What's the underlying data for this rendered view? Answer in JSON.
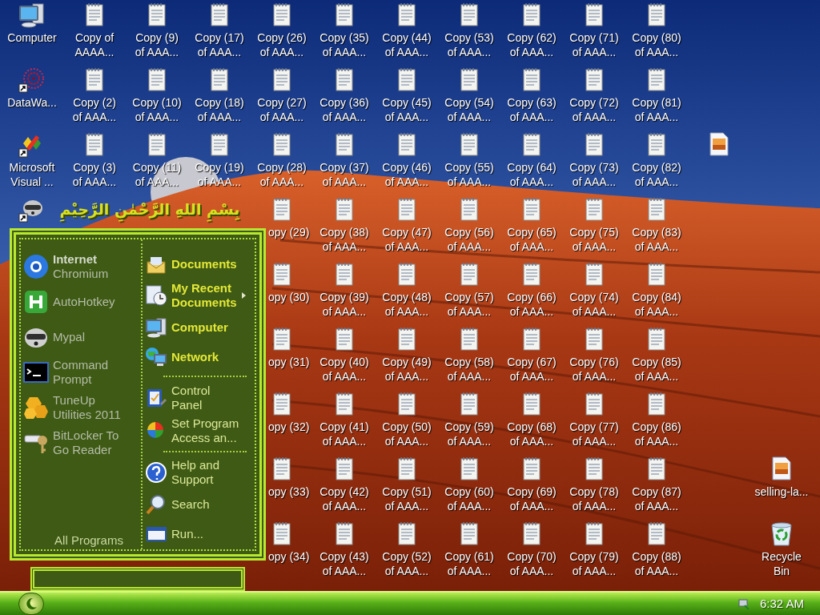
{
  "desktop": {
    "columns": [
      [
        {
          "kind": "computer",
          "lines": [
            "Computer"
          ]
        },
        {
          "kind": "datawave",
          "lines": [
            "DataWa..."
          ]
        },
        {
          "kind": "studio",
          "lines": [
            "Microsoft",
            "Visual ..."
          ]
        },
        {
          "kind": "raccoon"
        },
        {
          "kind": "empty"
        },
        {
          "kind": "empty"
        },
        {
          "kind": "empty"
        },
        {
          "kind": "empty"
        },
        {
          "kind": "empty"
        }
      ],
      [
        {
          "kind": "doc",
          "lines": [
            "Copy of",
            "AAAA..."
          ]
        },
        {
          "kind": "doc",
          "lines": [
            "Copy (2)",
            "of AAA..."
          ]
        },
        {
          "kind": "doc",
          "lines": [
            "Copy (3)",
            "of AAA..."
          ]
        },
        {
          "kind": "empty"
        },
        {
          "kind": "empty"
        },
        {
          "kind": "empty"
        },
        {
          "kind": "empty"
        },
        {
          "kind": "empty"
        },
        {
          "kind": "empty"
        }
      ],
      [
        {
          "kind": "doc",
          "lines": [
            "Copy (9)",
            "of AAA..."
          ]
        },
        {
          "kind": "doc",
          "lines": [
            "Copy (10)",
            "of AAA..."
          ]
        },
        {
          "kind": "doc",
          "lines": [
            "Copy (11)",
            "of AAA..."
          ]
        },
        {
          "kind": "empty"
        },
        {
          "kind": "empty"
        },
        {
          "kind": "empty"
        },
        {
          "kind": "empty"
        },
        {
          "kind": "empty"
        },
        {
          "kind": "empty"
        }
      ],
      [
        {
          "kind": "doc",
          "lines": [
            "Copy (17)",
            "of AAA..."
          ]
        },
        {
          "kind": "doc",
          "lines": [
            "Copy (18)",
            "of AAA..."
          ]
        },
        {
          "kind": "doc",
          "lines": [
            "Copy (19)",
            "of AAA..."
          ]
        },
        {
          "kind": "empty"
        },
        {
          "kind": "empty"
        },
        {
          "kind": "empty"
        },
        {
          "kind": "empty"
        },
        {
          "kind": "empty"
        },
        {
          "kind": "empty"
        }
      ],
      [
        {
          "kind": "doc",
          "lines": [
            "Copy (26)",
            "of AAA..."
          ]
        },
        {
          "kind": "doc",
          "lines": [
            "Copy (27)",
            "of AAA..."
          ]
        },
        {
          "kind": "doc",
          "lines": [
            "Copy (28)",
            "of AAA..."
          ]
        },
        {
          "kind": "doc-cut",
          "lines": [
            "opy (29)"
          ]
        },
        {
          "kind": "doc-cut",
          "lines": [
            "opy (30)"
          ]
        },
        {
          "kind": "doc-cut",
          "lines": [
            "opy (31)"
          ]
        },
        {
          "kind": "doc-cut",
          "lines": [
            "opy (32)"
          ]
        },
        {
          "kind": "doc-cut",
          "lines": [
            "opy (33)"
          ]
        },
        {
          "kind": "doc-cut",
          "lines": [
            "opy (34)"
          ]
        }
      ],
      [
        {
          "kind": "doc",
          "lines": [
            "Copy (35)",
            "of AAA..."
          ]
        },
        {
          "kind": "doc",
          "lines": [
            "Copy (36)",
            "of AAA..."
          ]
        },
        {
          "kind": "doc",
          "lines": [
            "Copy (37)",
            "of AAA..."
          ]
        },
        {
          "kind": "doc",
          "lines": [
            "Copy (38)",
            "of AAA..."
          ]
        },
        {
          "kind": "doc",
          "lines": [
            "Copy (39)",
            "of AAA..."
          ]
        },
        {
          "kind": "doc",
          "lines": [
            "Copy (40)",
            "of AAA..."
          ]
        },
        {
          "kind": "doc",
          "lines": [
            "Copy (41)",
            "of AAA..."
          ]
        },
        {
          "kind": "doc",
          "lines": [
            "Copy (42)",
            "of AAA..."
          ]
        },
        {
          "kind": "doc",
          "lines": [
            "Copy (43)",
            "of AAA..."
          ]
        }
      ],
      [
        {
          "kind": "doc",
          "lines": [
            "Copy (44)",
            "of AAA..."
          ]
        },
        {
          "kind": "doc",
          "lines": [
            "Copy (45)",
            "of AAA..."
          ]
        },
        {
          "kind": "doc",
          "lines": [
            "Copy (46)",
            "of AAA..."
          ]
        },
        {
          "kind": "doc",
          "lines": [
            "Copy (47)",
            "of AAA..."
          ]
        },
        {
          "kind": "doc",
          "lines": [
            "Copy (48)",
            "of AAA..."
          ]
        },
        {
          "kind": "doc",
          "lines": [
            "Copy (49)",
            "of AAA..."
          ]
        },
        {
          "kind": "doc",
          "lines": [
            "Copy (50)",
            "of AAA..."
          ]
        },
        {
          "kind": "doc",
          "lines": [
            "Copy (51)",
            "of AAA..."
          ]
        },
        {
          "kind": "doc",
          "lines": [
            "Copy (52)",
            "of AAA..."
          ]
        }
      ],
      [
        {
          "kind": "doc",
          "lines": [
            "Copy (53)",
            "of AAA..."
          ]
        },
        {
          "kind": "doc",
          "lines": [
            "Copy (54)",
            "of AAA..."
          ]
        },
        {
          "kind": "doc",
          "lines": [
            "Copy (55)",
            "of AAA..."
          ]
        },
        {
          "kind": "doc",
          "lines": [
            "Copy (56)",
            "of AAA..."
          ]
        },
        {
          "kind": "doc",
          "lines": [
            "Copy (57)",
            "of AAA..."
          ]
        },
        {
          "kind": "doc",
          "lines": [
            "Copy (58)",
            "of AAA..."
          ]
        },
        {
          "kind": "doc",
          "lines": [
            "Copy (59)",
            "of AAA..."
          ]
        },
        {
          "kind": "doc",
          "lines": [
            "Copy (60)",
            "of AAA..."
          ]
        },
        {
          "kind": "doc",
          "lines": [
            "Copy (61)",
            "of AAA..."
          ]
        }
      ],
      [
        {
          "kind": "doc",
          "lines": [
            "Copy (62)",
            "of AAA..."
          ]
        },
        {
          "kind": "doc",
          "lines": [
            "Copy (63)",
            "of AAA..."
          ]
        },
        {
          "kind": "doc",
          "lines": [
            "Copy (64)",
            "of AAA..."
          ]
        },
        {
          "kind": "doc",
          "lines": [
            "Copy (65)",
            "of AAA..."
          ]
        },
        {
          "kind": "doc",
          "lines": [
            "Copy (66)",
            "of AAA..."
          ]
        },
        {
          "kind": "doc",
          "lines": [
            "Copy (67)",
            "of AAA..."
          ]
        },
        {
          "kind": "doc",
          "lines": [
            "Copy (68)",
            "of AAA..."
          ]
        },
        {
          "kind": "doc",
          "lines": [
            "Copy (69)",
            "of AAA..."
          ]
        },
        {
          "kind": "doc",
          "lines": [
            "Copy (70)",
            "of AAA..."
          ]
        }
      ],
      [
        {
          "kind": "doc",
          "lines": [
            "Copy (71)",
            "of AAA..."
          ]
        },
        {
          "kind": "doc",
          "lines": [
            "Copy (72)",
            "of AAA..."
          ]
        },
        {
          "kind": "doc",
          "lines": [
            "Copy (73)",
            "of AAA..."
          ]
        },
        {
          "kind": "doc",
          "lines": [
            "Copy (75)",
            "of AAA..."
          ]
        },
        {
          "kind": "doc",
          "lines": [
            "Copy (74)",
            "of AAA..."
          ]
        },
        {
          "kind": "doc",
          "lines": [
            "Copy (76)",
            "of AAA..."
          ]
        },
        {
          "kind": "doc",
          "lines": [
            "Copy (77)",
            "of AAA..."
          ]
        },
        {
          "kind": "doc",
          "lines": [
            "Copy (78)",
            "of AAA..."
          ]
        },
        {
          "kind": "doc",
          "lines": [
            "Copy (79)",
            "of AAA..."
          ]
        }
      ],
      [
        {
          "kind": "doc",
          "lines": [
            "Copy (80)",
            "of AAA..."
          ]
        },
        {
          "kind": "doc",
          "lines": [
            "Copy (81)",
            "of AAA..."
          ]
        },
        {
          "kind": "doc",
          "lines": [
            "Copy (82)",
            "of AAA..."
          ]
        },
        {
          "kind": "doc",
          "lines": [
            "Copy (83)",
            "of AAA..."
          ]
        },
        {
          "kind": "doc",
          "lines": [
            "Copy (84)",
            "of AAA..."
          ]
        },
        {
          "kind": "doc",
          "lines": [
            "Copy (85)",
            "of AAA..."
          ]
        },
        {
          "kind": "doc",
          "lines": [
            "Copy (86)",
            "of AAA..."
          ]
        },
        {
          "kind": "doc",
          "lines": [
            "Copy (87)",
            "of AAA..."
          ]
        },
        {
          "kind": "doc",
          "lines": [
            "Copy (88)",
            "of AAA..."
          ]
        }
      ],
      [
        {
          "kind": "empty"
        },
        {
          "kind": "empty"
        },
        {
          "kind": "image"
        },
        {
          "kind": "empty"
        },
        {
          "kind": "empty"
        },
        {
          "kind": "empty"
        },
        {
          "kind": "empty"
        },
        {
          "kind": "empty"
        },
        {
          "kind": "empty"
        }
      ],
      [
        {
          "kind": "empty"
        },
        {
          "kind": "empty"
        },
        {
          "kind": "empty"
        },
        {
          "kind": "empty"
        },
        {
          "kind": "empty"
        },
        {
          "kind": "empty"
        },
        {
          "kind": "empty"
        },
        {
          "kind": "image",
          "lines": [
            "selling-la..."
          ]
        },
        {
          "kind": "recycle",
          "lines": [
            "Recycle",
            "Bin"
          ]
        }
      ]
    ]
  },
  "start_menu": {
    "banner": "بِسْمِ اللهِ الرَّحْمٰنِ الرَّحِيْمِ",
    "programs": [
      {
        "kind": "default",
        "title": "Internet",
        "subtitle": "Chromium"
      },
      {
        "kind": "app",
        "lines": [
          "AutoHotkey"
        ]
      },
      {
        "kind": "app",
        "lines": [
          "Mypal"
        ]
      },
      {
        "kind": "app",
        "lines": [
          "Command",
          "Prompt"
        ]
      },
      {
        "kind": "app",
        "lines": [
          "TuneUp",
          "Utilities 2011"
        ]
      },
      {
        "kind": "app",
        "lines": [
          "BitLocker To",
          "Go Reader"
        ]
      }
    ],
    "all_programs": "All Programs",
    "places": [
      {
        "kind": "place",
        "lines": [
          "Documents"
        ],
        "has_submenu": false
      },
      {
        "kind": "place",
        "lines": [
          "My Recent",
          "Documents"
        ],
        "has_submenu": true
      },
      {
        "kind": "place",
        "lines": [
          "Computer"
        ],
        "has_submenu": false
      },
      {
        "kind": "place",
        "lines": [
          "Network"
        ],
        "has_submenu": false
      },
      {
        "kind": "separator"
      },
      {
        "kind": "tool",
        "lines": [
          "Control",
          "Panel"
        ],
        "has_submenu": false
      },
      {
        "kind": "tool",
        "lines": [
          "Set Program",
          "Access an..."
        ],
        "has_submenu": false
      },
      {
        "kind": "separator"
      },
      {
        "kind": "tool",
        "lines": [
          "Help and",
          "Support"
        ],
        "has_submenu": false
      },
      {
        "kind": "tool",
        "lines": [
          "Search"
        ],
        "has_submenu": false
      },
      {
        "kind": "tool",
        "lines": [
          "Run..."
        ],
        "has_submenu": false
      }
    ]
  },
  "taskbar": {
    "clock": "6:32 AM"
  }
}
